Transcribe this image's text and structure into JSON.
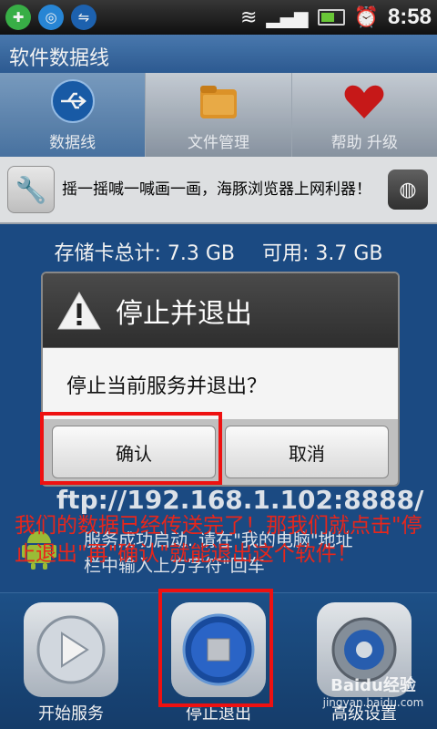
{
  "status_bar": {
    "time": "8:58",
    "icons": [
      "app-icon",
      "qq-icon",
      "usb-icon",
      "wifi-icon",
      "signal-icon",
      "battery-icon",
      "alarm-icon"
    ]
  },
  "app": {
    "title": "软件数据线"
  },
  "tabs": [
    {
      "label": "数据线",
      "icon": "usb-icon",
      "active": true
    },
    {
      "label": "文件管理",
      "icon": "folder-icon",
      "active": false
    },
    {
      "label": "帮助 升级",
      "icon": "heart-icon",
      "active": false
    }
  ],
  "banner": {
    "text": "摇一摇喊一喊画一画，海豚浏览器上网利器！"
  },
  "storage": {
    "total": "存储卡总计: 7.3 GB",
    "available": "可用: 3.7 GB"
  },
  "background": {
    "ftp_url": "ftp://192.168.1.102:8888/",
    "status_line1": "服务成功启动. 请在\"我的电脑\"地址",
    "status_line2": "栏中输入上方字符\"回车"
  },
  "dialog": {
    "title": "停止并退出",
    "message": "停止当前服务并退出？",
    "confirm_label": "确认",
    "cancel_label": "取消"
  },
  "annotation": {
    "text": "我们的数据已经传送完了！那我们就点击\"停止退出\"再\"确认\"就能退出这个软件！",
    "color": "#e8261b"
  },
  "bottom_bar": {
    "start_label": "开始服务",
    "stop_label": "停止退出",
    "settings_label": "高级设置"
  },
  "watermark": {
    "brand": "Baidu经验",
    "url": "jingyan.baidu.com"
  }
}
